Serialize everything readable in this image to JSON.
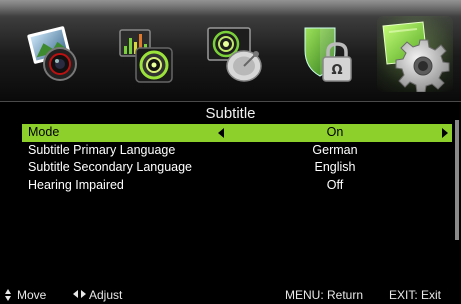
{
  "colors": {
    "highlight": "#8ed02b",
    "background": "#000000",
    "text": "#ffffff"
  },
  "menu_bar": {
    "icons": [
      {
        "name": "picture-icon",
        "selected": false
      },
      {
        "name": "sound-icon",
        "selected": false
      },
      {
        "name": "channel-icon",
        "selected": false
      },
      {
        "name": "lock-icon",
        "selected": false
      },
      {
        "name": "setup-icon",
        "selected": true
      }
    ]
  },
  "panel": {
    "title": "Subtitle",
    "rows": [
      {
        "label": "Mode",
        "value": "On",
        "selected": true
      },
      {
        "label": "Subtitle Primary Language",
        "value": "German",
        "selected": false
      },
      {
        "label": "Subtitle Secondary Language",
        "value": "English",
        "selected": false
      },
      {
        "label": "Hearing Impaired",
        "value": "Off",
        "selected": false
      }
    ]
  },
  "footer": {
    "move": "Move",
    "adjust": "Adjust",
    "menu_return": "MENU: Return",
    "exit": "EXIT: Exit"
  }
}
